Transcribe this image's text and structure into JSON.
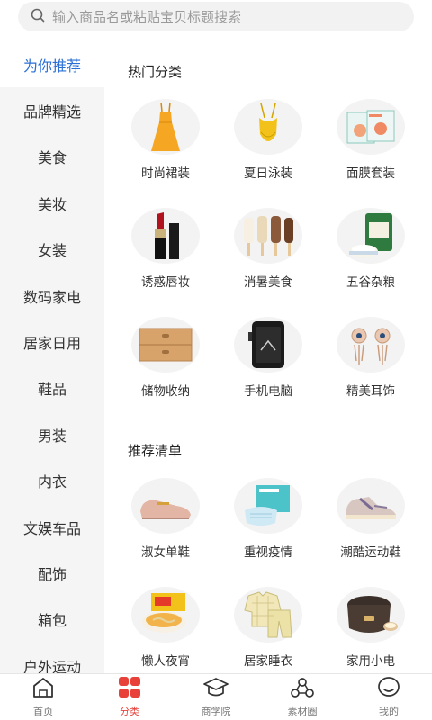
{
  "search": {
    "placeholder": "输入商品名或粘贴宝贝标题搜索"
  },
  "sidebar": {
    "items": [
      {
        "label": "为你推荐",
        "active": true
      },
      {
        "label": "品牌精选"
      },
      {
        "label": "美食"
      },
      {
        "label": "美妆"
      },
      {
        "label": "女装"
      },
      {
        "label": "数码家电"
      },
      {
        "label": "居家日用"
      },
      {
        "label": "鞋品"
      },
      {
        "label": "男装"
      },
      {
        "label": "内衣"
      },
      {
        "label": "文娱车品"
      },
      {
        "label": "配饰"
      },
      {
        "label": "箱包"
      },
      {
        "label": "户外运动"
      }
    ]
  },
  "hot": {
    "title": "热门分类",
    "items": [
      {
        "label": "时尚裙装",
        "icon": "dress-icon"
      },
      {
        "label": "夏日泳装",
        "icon": "swimsuit-icon"
      },
      {
        "label": "面膜套装",
        "icon": "facemask-icon"
      },
      {
        "label": "诱惑唇妆",
        "icon": "lipstick-icon"
      },
      {
        "label": "消暑美食",
        "icon": "popsicle-icon"
      },
      {
        "label": "五谷杂粮",
        "icon": "rice-icon"
      },
      {
        "label": "储物收纳",
        "icon": "drawer-icon"
      },
      {
        "label": "手机电脑",
        "icon": "phone-icon"
      },
      {
        "label": "精美耳饰",
        "icon": "earring-icon"
      }
    ]
  },
  "recommend": {
    "title": "推荐清单",
    "items": [
      {
        "label": "淑女单鞋",
        "icon": "loafer-icon"
      },
      {
        "label": "重视疫情",
        "icon": "mask-icon"
      },
      {
        "label": "潮酷运动鞋",
        "icon": "sneaker-icon"
      },
      {
        "label": "懒人夜宵",
        "icon": "noodles-icon"
      },
      {
        "label": "居家睡衣",
        "icon": "pajamas-icon"
      },
      {
        "label": "家用小电",
        "icon": "ricecooker-icon"
      }
    ]
  },
  "tabbar": {
    "items": [
      {
        "label": "首页",
        "icon": "home-icon"
      },
      {
        "label": "分类",
        "icon": "category-icon",
        "active": true
      },
      {
        "label": "商学院",
        "icon": "graduation-cap-icon"
      },
      {
        "label": "素材圈",
        "icon": "material-circle-icon"
      },
      {
        "label": "我的",
        "icon": "profile-icon"
      }
    ]
  },
  "colors": {
    "active_sidebar": "#2a6fd6",
    "active_tab": "#e8413a"
  }
}
